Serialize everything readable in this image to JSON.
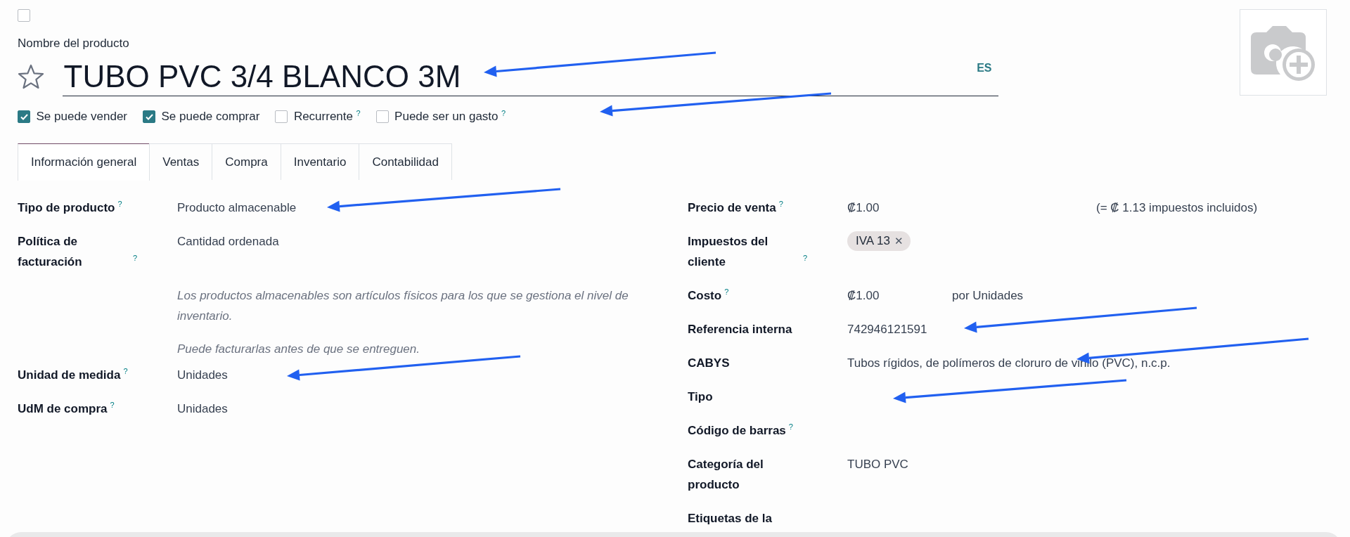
{
  "archive_checkbox": {
    "checked": false
  },
  "name_label": "Nombre del producto",
  "favorite": {
    "starred": false
  },
  "product_name": "TUBO PVC 3/4 BLANCO 3M",
  "language": "ES",
  "options": [
    {
      "label": "Se puede vender",
      "checked": true
    },
    {
      "label": "Se puede comprar",
      "checked": true
    },
    {
      "label": "Recurrente",
      "checked": false,
      "help": "?"
    },
    {
      "label": "Puede ser un gasto",
      "checked": false,
      "help": "?"
    }
  ],
  "tabs": [
    {
      "label": "Información general",
      "selected": true
    },
    {
      "label": "Ventas",
      "selected": false
    },
    {
      "label": "Compra",
      "selected": false
    },
    {
      "label": "Inventario",
      "selected": false
    },
    {
      "label": "Contabilidad",
      "selected": false
    }
  ],
  "left_fields": [
    {
      "kind": "field",
      "label": "Tipo de producto",
      "help": "?",
      "value": "Producto almacenable"
    },
    {
      "kind": "field",
      "label": "Política de facturación",
      "help": "?",
      "value": "Cantidad ordenada"
    },
    {
      "kind": "note",
      "paragraphs": [
        "Los productos almacenables son artículos físicos para los que se gestiona el nivel de inventario.",
        "Puede facturarlas antes de que se entreguen."
      ]
    },
    {
      "kind": "field",
      "label": "Unidad de medida",
      "help": "?",
      "value": "Unidades"
    },
    {
      "kind": "field",
      "label": "UdM de compra",
      "help": "?",
      "value": "Unidades"
    }
  ],
  "right_fields": [
    {
      "kind": "price",
      "label": "Precio de venta",
      "help": "?",
      "value": "₡1.00",
      "extra": "(= ₡ 1.13 impuestos incluidos)"
    },
    {
      "kind": "tags",
      "label": "Impuestos del cliente",
      "help": "?",
      "tags": [
        {
          "label": "IVA 13",
          "remove": "✕"
        }
      ]
    },
    {
      "kind": "cost",
      "label": "Costo",
      "help": "?",
      "value": "₡1.00",
      "extra": "por Unidades"
    },
    {
      "kind": "field",
      "label": "Referencia interna",
      "value": "742946121591"
    },
    {
      "kind": "field",
      "label": "CABYS",
      "value": "Tubos rígidos, de polímeros de cloruro de vinilo (PVC), n.c.p."
    },
    {
      "kind": "field",
      "label": "Tipo"
    },
    {
      "kind": "field",
      "label": "Código de barras",
      "help": "?"
    },
    {
      "kind": "field",
      "label": "Categoría del producto",
      "value": "TUBO PVC"
    },
    {
      "kind": "field",
      "label": "Etiquetas de la"
    }
  ]
}
